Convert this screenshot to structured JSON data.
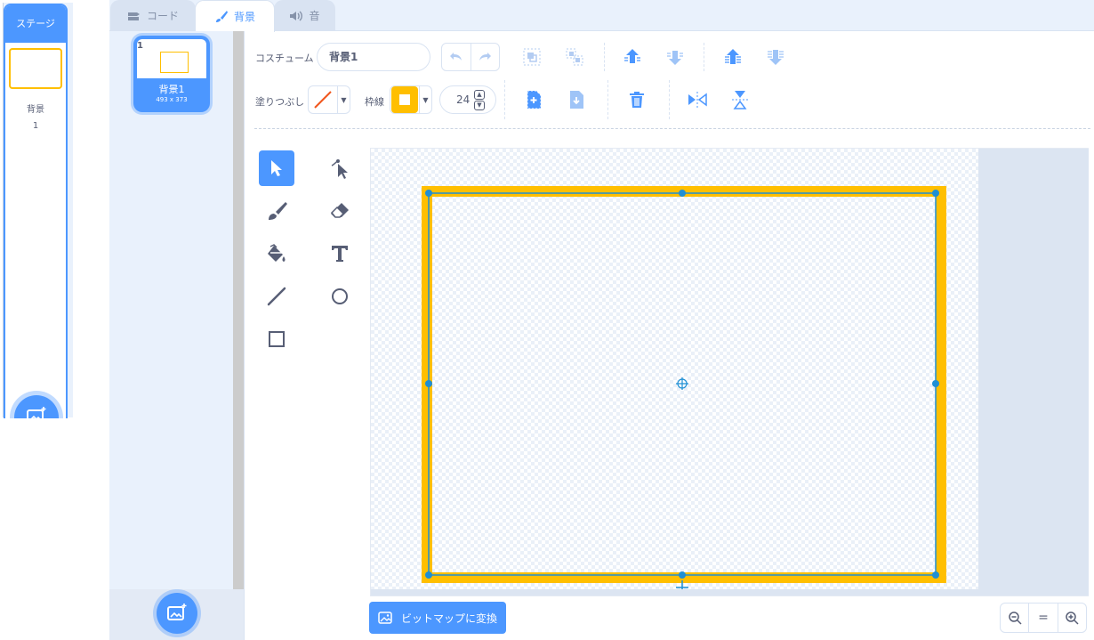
{
  "stage": {
    "header": "ステージ",
    "backdrops_label": "背景",
    "backdrops_count": "1"
  },
  "tabs": [
    {
      "label": "コード",
      "icon": "code-icon"
    },
    {
      "label": "背景",
      "icon": "brush-icon"
    },
    {
      "label": "音",
      "icon": "speaker-icon"
    }
  ],
  "costume_list": [
    {
      "number": "1",
      "name": "背景1",
      "size": "493 x 373"
    }
  ],
  "toolbar": {
    "costume_label": "コスチューム",
    "costume_name": "背景1",
    "fill_label": "塗りつぶし",
    "outline_label": "枠線",
    "outline_width": "24",
    "fill_color": "none",
    "outline_color": "#ffab19"
  },
  "tools": [
    {
      "name": "select-tool",
      "icon": "arrow-cursor-icon"
    },
    {
      "name": "reshape-tool",
      "icon": "reshape-icon"
    },
    {
      "name": "brush-tool",
      "icon": "brush-icon"
    },
    {
      "name": "eraser-tool",
      "icon": "eraser-icon"
    },
    {
      "name": "fill-tool",
      "icon": "paint-bucket-icon"
    },
    {
      "name": "text-tool",
      "icon": "text-icon"
    },
    {
      "name": "line-tool",
      "icon": "line-icon"
    },
    {
      "name": "circle-tool",
      "icon": "circle-icon"
    },
    {
      "name": "rectangle-tool",
      "icon": "rectangle-icon"
    }
  ],
  "canvas": {
    "convert_button": "ビットマップに変換"
  },
  "zoom": {
    "out": "zoom-out-icon",
    "reset": "=",
    "in": "zoom-in-icon"
  },
  "colors": {
    "accent": "#4c97ff",
    "selection_outline": "#ffbf00",
    "handle": "#1f8fd4"
  }
}
